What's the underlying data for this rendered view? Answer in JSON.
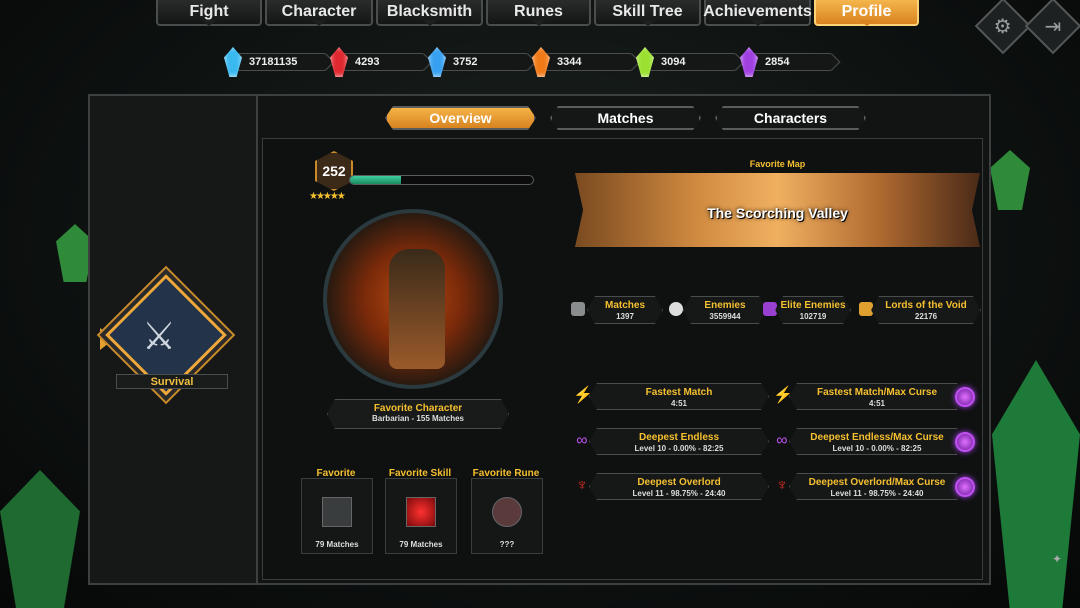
{
  "nav": {
    "tabs": [
      "Fight",
      "Character",
      "Blacksmith",
      "Runes",
      "Skill Tree",
      "Achievements",
      "Profile"
    ],
    "active": "Profile"
  },
  "currencies": [
    {
      "color": "#3ab8f0",
      "value": "37181135"
    },
    {
      "color": "#e02830",
      "value": "4293"
    },
    {
      "color": "#38a0f0",
      "value": "3752"
    },
    {
      "color": "#f07a18",
      "value": "3344"
    },
    {
      "color": "#9ae030",
      "value": "3094"
    },
    {
      "color": "#a040e0",
      "value": "2854"
    }
  ],
  "subtabs": [
    "Overview",
    "Matches",
    "Characters"
  ],
  "mode": {
    "label": "Survival",
    "icon": "crossed-swords-shield-icon"
  },
  "profile": {
    "level": "252",
    "xp_fraction": 0.28,
    "favorite_character_label": "Favorite Character",
    "favorite_character_value": "Barbarian - 155 Matches"
  },
  "favorites": [
    {
      "title": "Favorite Weapon",
      "value": "79 Matches",
      "icon": "axe-icon"
    },
    {
      "title": "Favorite Skill",
      "value": "79 Matches",
      "icon": "skill-icon"
    },
    {
      "title": "Favorite Rune",
      "value": "???",
      "icon": "rune-icon"
    }
  ],
  "map": {
    "label": "Favorite Map",
    "name": "The Scorching Valley"
  },
  "stats": [
    {
      "label": "Matches",
      "value": "1397",
      "icon": "crossed-swords-icon"
    },
    {
      "label": "Enemies",
      "value": "3559944",
      "icon": "skull-icon"
    },
    {
      "label": "Elite Enemies",
      "value": "102719",
      "icon": "demon-icon"
    },
    {
      "label": "Lords of the Void",
      "value": "22176",
      "icon": "crown-icon"
    }
  ],
  "records": [
    {
      "label": "Fastest Match",
      "value": "4:51",
      "icon": "lightning-icon"
    },
    {
      "label": "Fastest Match/Max Curse",
      "value": "4:51",
      "icon": "lightning-icon"
    },
    {
      "label": "Deepest Endless",
      "value": "Level 10 - 0.00% - 82:25",
      "icon": "infinity-icon"
    },
    {
      "label": "Deepest Endless/Max Curse",
      "value": "Level 10 - 0.00% - 82:25",
      "icon": "infinity-icon"
    },
    {
      "label": "Deepest Overlord",
      "value": "Level 11 - 98.75% - 24:40",
      "icon": "overlord-icon"
    },
    {
      "label": "Deepest Overlord/Max Curse",
      "value": "Level 11 - 98.75% - 24:40",
      "icon": "overlord-icon"
    }
  ]
}
